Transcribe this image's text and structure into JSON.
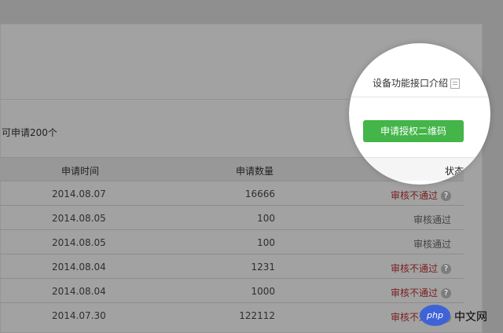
{
  "quota_text": "可申请200个",
  "doc_link": "设备功能接口介绍",
  "qr_button": "申请授权二维码",
  "table": {
    "headers": {
      "time": "申请时间",
      "count": "申请数量",
      "status": "状态"
    },
    "rows": [
      {
        "time": "2014.08.07",
        "count": "16666",
        "status": "审核不通过",
        "state": "fail"
      },
      {
        "time": "2014.08.05",
        "count": "100",
        "status": "审核通过",
        "state": "pass"
      },
      {
        "time": "2014.08.05",
        "count": "100",
        "status": "审核通过",
        "state": "pass"
      },
      {
        "time": "2014.08.04",
        "count": "1231",
        "status": "审核不通过",
        "state": "fail"
      },
      {
        "time": "2014.08.04",
        "count": "1000",
        "status": "审核不通过",
        "state": "fail"
      },
      {
        "time": "2014.07.30",
        "count": "122112",
        "status": "审核不通过",
        "state": "fail"
      }
    ]
  },
  "help_glyph": "?",
  "watermark": {
    "badge": "php",
    "text": "中文网"
  },
  "colors": {
    "accent": "#44b549",
    "fail": "#7a1e1e"
  }
}
